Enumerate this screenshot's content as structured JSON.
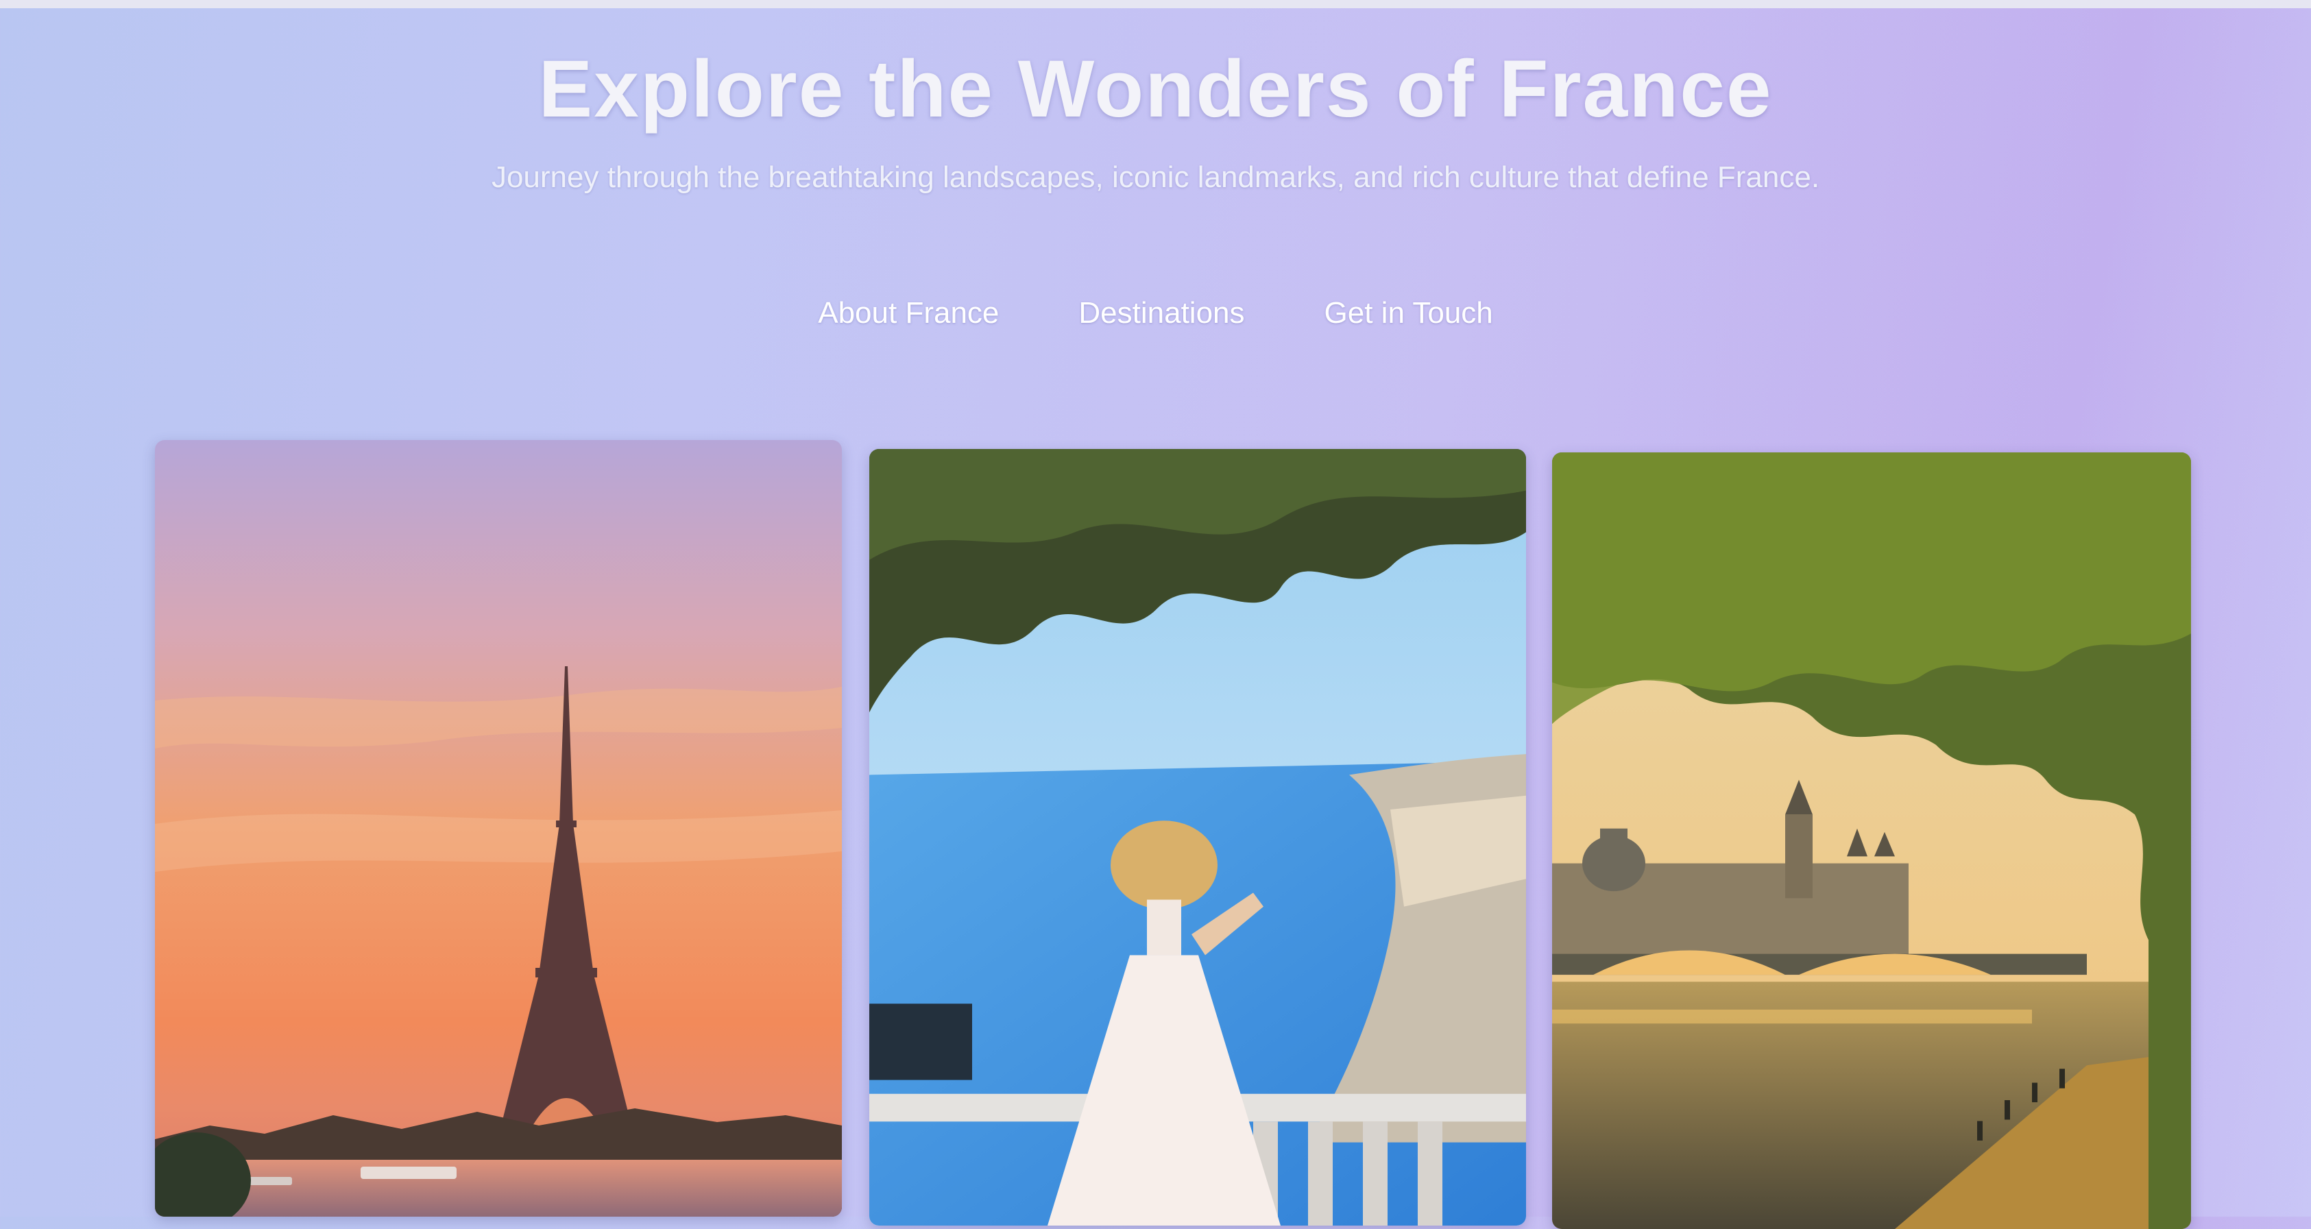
{
  "header": {
    "title": "Explore the Wonders of France",
    "subtitle": "Journey through the breathtaking landscapes, iconic landmarks, and rich culture that define France."
  },
  "nav": {
    "items": [
      "About France",
      "Destinations",
      "Get in Touch"
    ]
  },
  "gallery": {
    "cards": [
      {
        "subject": "eiffel-tower-at-sunset"
      },
      {
        "subject": "woman-in-white-dress-overlooking-nice-coast"
      },
      {
        "subject": "conciergerie-and-seine-river-bridge"
      }
    ]
  },
  "colors": {
    "background": "#c2c0f4",
    "title_text": "#f3f3f9",
    "nav_text": "#ffffff"
  }
}
